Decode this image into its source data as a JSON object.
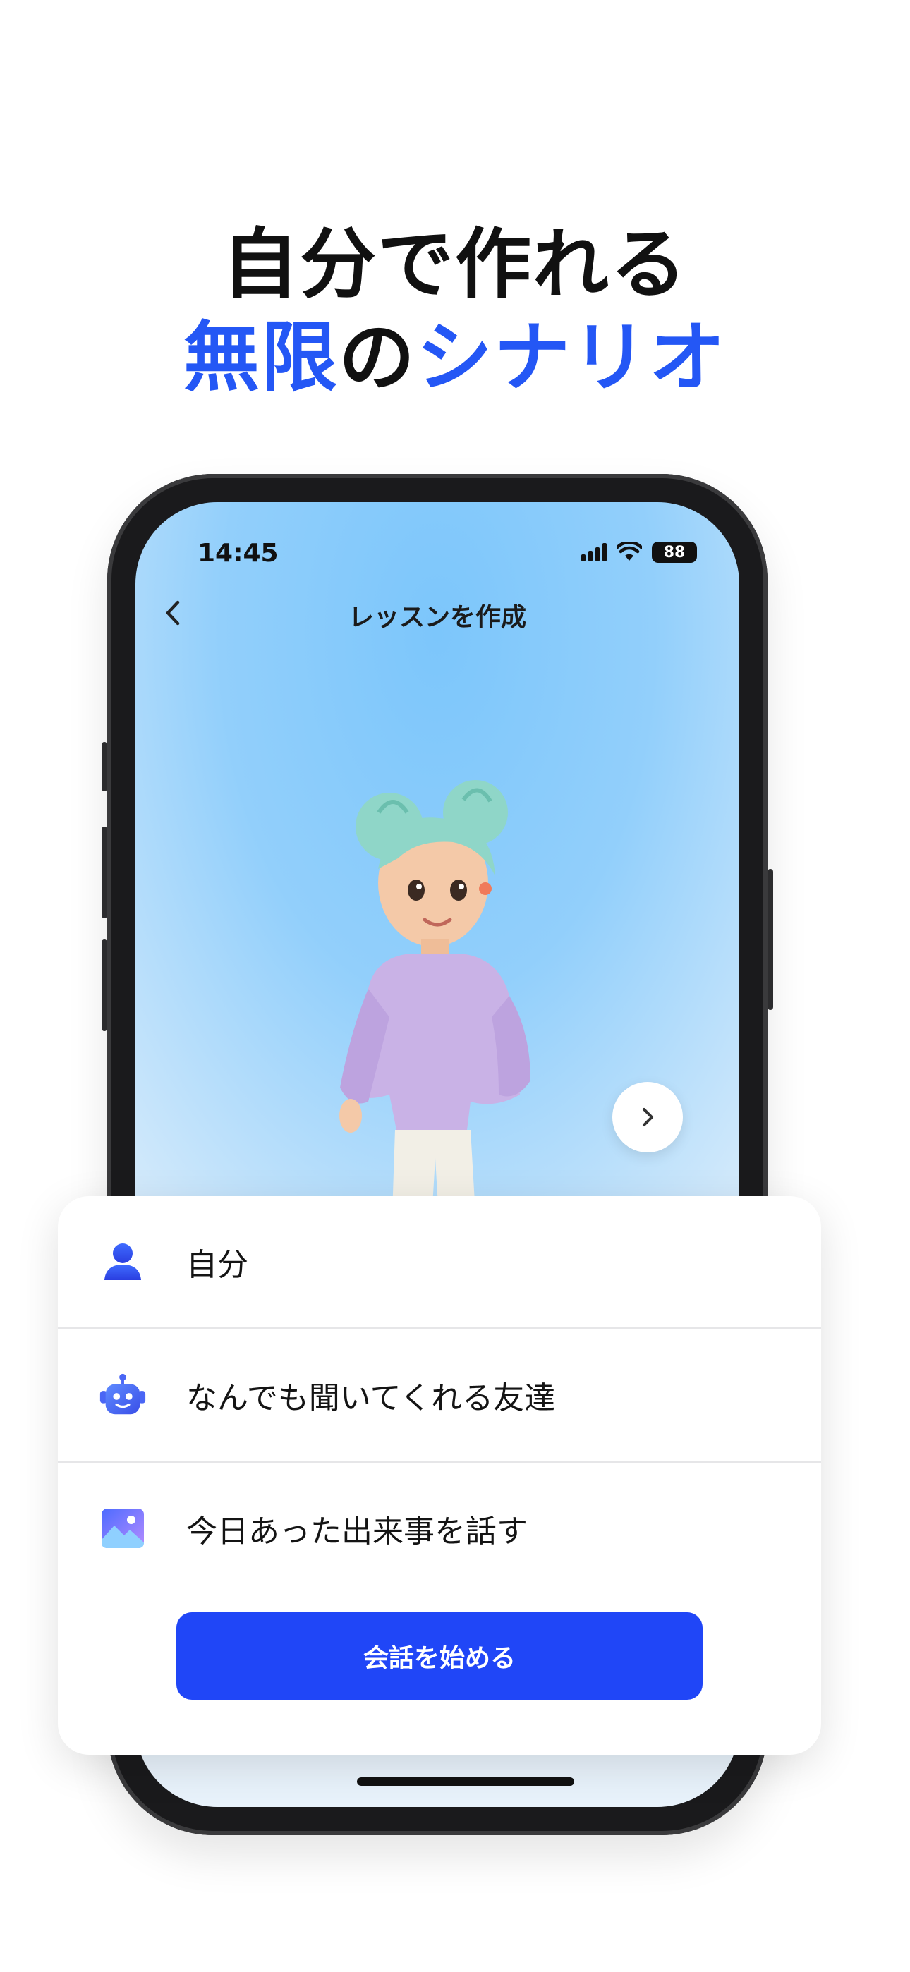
{
  "headline": {
    "line1": "自分で作れる",
    "line2_accent_a": "無限",
    "line2_plain": "の",
    "line2_accent_b": "シナリオ"
  },
  "status_bar": {
    "time": "14:45",
    "battery": "88"
  },
  "nav": {
    "title": "レッスンを作成"
  },
  "options": [
    {
      "label": "自分",
      "icon": "person-icon"
    },
    {
      "label": "なんでも聞いてくれる友達",
      "icon": "robot-icon"
    },
    {
      "label": "今日あった出来事を話す",
      "icon": "image-icon"
    }
  ],
  "cta": {
    "label": "会話を始める"
  },
  "colors": {
    "accent": "#2457f5",
    "button": "#2046f7"
  }
}
